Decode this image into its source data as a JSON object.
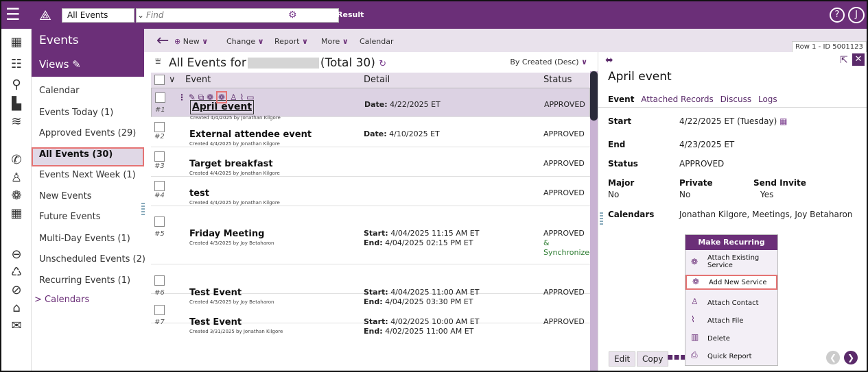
{
  "topbar": {
    "view_select": "All Events",
    "find_placeholder": "Find",
    "filter_label": "Filter Result",
    "help_label": "?",
    "user_initial": "J"
  },
  "section": {
    "title": "Events",
    "views_label": "Views"
  },
  "toolbar": {
    "new": "New",
    "change": "Change",
    "report": "Report",
    "more": "More",
    "calendar": "Calendar",
    "row_id": "Row 1 - ID 5001123"
  },
  "views": [
    "Calendar",
    "Events Today (1)",
    "Approved Events (29)",
    "All Events (30)",
    "Events Next Week (1)",
    "New Events",
    "Future Events",
    "Multi-Day Events (1)",
    "Unscheduled Events (2)",
    "Recurring Events (1)"
  ],
  "calendars_link": "> Calendars",
  "list": {
    "title_prefix": "All Events for",
    "total": "(Total 30)",
    "sort": "By Created (Desc)",
    "col_event": "Event",
    "col_detail": "Detail",
    "col_status": "Status"
  },
  "rows": [
    {
      "num": "#1",
      "name": "April event",
      "created": "Created 4/4/2025 by Jonathan Kilgore",
      "d1l": "Date:",
      "d1": "4/22/2025 ET",
      "d2l": "",
      "d2": "",
      "status": "APPROVED",
      "status2": "",
      "status3": ""
    },
    {
      "num": "#2",
      "name": "External attendee event",
      "created": "Created 4/4/2025 by Jonathan Kilgore",
      "d1l": "Date:",
      "d1": "4/10/2025 ET",
      "d2l": "",
      "d2": "",
      "status": "APPROVED",
      "status2": "",
      "status3": ""
    },
    {
      "num": "#3",
      "name": "Target breakfast",
      "created": "Created 4/4/2025 by Jonathan Kilgore",
      "d1l": "",
      "d1": "",
      "d2l": "",
      "d2": "",
      "status": "APPROVED",
      "status2": "",
      "status3": ""
    },
    {
      "num": "#4",
      "name": "test",
      "created": "Created 4/4/2025 by Jonathan Kilgore",
      "d1l": "",
      "d1": "",
      "d2l": "",
      "d2": "",
      "status": "APPROVED",
      "status2": "",
      "status3": ""
    },
    {
      "num": "#5",
      "name": "Friday Meeting",
      "created": "Created 4/3/2025 by Joy Betaharon",
      "d1l": "Start:",
      "d1": "4/04/2025 11:15 AM ET",
      "d2l": "End:",
      "d2": "4/04/2025 02:15 PM ET",
      "status": "APPROVED",
      "status2": "&",
      "status3": "Synchronized"
    },
    {
      "num": "#6",
      "name": "Test Event",
      "created": "Created 4/3/2025 by Joy Betaharon",
      "d1l": "Start:",
      "d1": "4/04/2025 11:00 AM ET",
      "d2l": "End:",
      "d2": "4/04/2025 03:30 PM ET",
      "status": "APPROVED",
      "status2": "",
      "status3": ""
    },
    {
      "num": "#7",
      "name": "Test Event",
      "created": "Created 3/31/2025 by Jonathan Kilgore",
      "d1l": "Start:",
      "d1": "4/02/2025 10:00 AM ET",
      "d2l": "End:",
      "d2": "4/02/2025 11:00 AM ET",
      "status": "APPROVED",
      "status2": "",
      "status3": ""
    }
  ],
  "detail": {
    "title": "April event",
    "tabs": [
      "Event",
      "Attached Records",
      "Discuss",
      "Logs"
    ],
    "start_label": "Start",
    "start_value": "4/22/2025 ET (Tuesday)",
    "end_label": "End",
    "end_value": "4/23/2025 ET",
    "status_label": "Status",
    "status_value": "APPROVED",
    "major_label": "Major",
    "major_value": "No",
    "private_label": "Private",
    "private_value": "No",
    "invite_label": "Send Invite",
    "invite_value": "Yes",
    "calendars_label": "Calendars",
    "calendars_value": "Jonathan Kilgore, Meetings, Joy Betaharon",
    "edit": "Edit",
    "copy": "Copy"
  },
  "menu": {
    "header": "Make Recurring",
    "attach_existing_1": "Attach Existing",
    "attach_existing_2": "Service",
    "add_new": "Add New Service",
    "attach_contact": "Attach Contact",
    "attach_file": "Attach File",
    "delete": "Delete",
    "quick_report": "Quick Report"
  },
  "colors": {
    "brand": "#6b2f78",
    "highlight": "#e57373",
    "selected_row": "#dcd2e3"
  }
}
